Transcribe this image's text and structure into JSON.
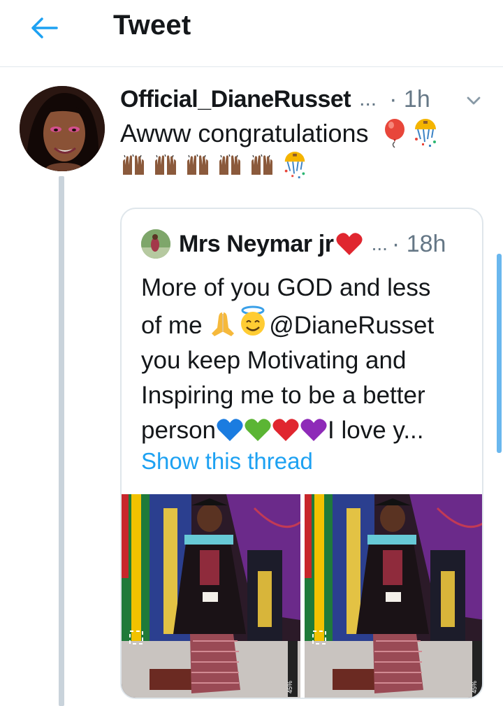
{
  "header": {
    "title": "Tweet",
    "back_icon": "arrow-left-icon"
  },
  "tweet": {
    "author": "Official_DianeRusset",
    "author_truncation": "...",
    "time": "· 1h",
    "text": "Awww congratulations",
    "emojis": [
      "balloon",
      "confetti-ball",
      "raised-hands",
      "raised-hands",
      "raised-hands",
      "raised-hands",
      "raised-hands",
      "confetti-ball"
    ],
    "menu_icon": "chevron-down-icon"
  },
  "quoted_tweet": {
    "author": "Mrs Neymar jr",
    "author_emoji": "red-heart",
    "author_truncation": "...",
    "time": "· 18h",
    "lines": {
      "l1": "More of you GOD and less",
      "l2_a": "of me ",
      "l2_b": "@DianeRusset",
      "l3": "you keep Motivating and",
      "l4": "Inspiring me to be a better",
      "l5_a": "person",
      "l5_b": "I love y..."
    },
    "show_thread": "Show this thread",
    "media": [
      {
        "alt": "graduation-photo-1"
      },
      {
        "alt": "graduation-photo-2"
      }
    ],
    "phone_status_overlay": "45%"
  },
  "colors": {
    "accent": "#1da1f2",
    "secondary_text": "#657786",
    "primary_text": "#14171a",
    "border": "#e1e8ed"
  }
}
